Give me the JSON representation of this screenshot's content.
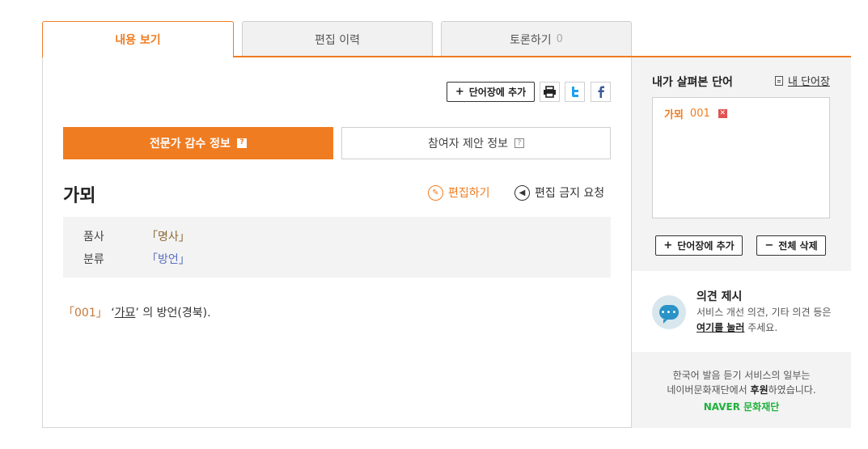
{
  "tabs": [
    {
      "label": "내용 보기"
    },
    {
      "label": "편집 이력"
    },
    {
      "label": "토론하기",
      "count": "0"
    }
  ],
  "toolbar": {
    "add_label": "단어장에 추가",
    "add_plus": "+",
    "print_icon": "printer-icon",
    "twitter_icon": "twitter-icon",
    "facebook_icon": "facebook-icon"
  },
  "info_tabs": {
    "expert": "전문가 감수 정보",
    "participant": "참여자 제안 정보",
    "help_glyph": "?"
  },
  "word": {
    "title": "가뫼",
    "edit": "편집하기",
    "edit_block": "편집 금지 요청",
    "pos_label": "품사",
    "pos_value": "「명사」",
    "category_label": "분류",
    "category_value": "「방언」"
  },
  "definition": {
    "number": "「001」",
    "open_quote": "‘",
    "ref": "가묘",
    "close_quote": "’",
    "text": "의 방언(경북)."
  },
  "sidebar": {
    "title": "내가 살펴본 단어",
    "my_vocab": "내 단어장",
    "items": [
      {
        "word": "가뫼",
        "num": "001"
      }
    ],
    "add_label": "단어장에 추가",
    "delete_all_label": "전체 삭제",
    "add_glyph": "+",
    "delete_glyph": "−"
  },
  "opinion": {
    "title": "의견 제시",
    "line1": "서비스 개선 의견, 기타 의견 등은",
    "link": "여기를 눌러",
    "line2_rest": " 주세요."
  },
  "sponsor": {
    "line1": "한국어 발음 듣기 서비스의 일부는",
    "line2_pre": "네이버문화재단에서 ",
    "line2_bold": "후원",
    "line2_post": "하였습니다.",
    "logo": "NAVER 문화재단"
  },
  "colors": {
    "accent": "#f07c21",
    "naver_green": "#1fb13c",
    "twitter": "#1da1f2",
    "facebook": "#3b5998"
  }
}
